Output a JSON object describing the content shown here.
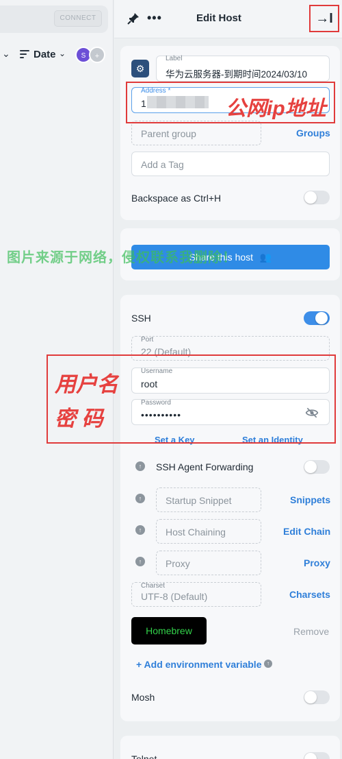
{
  "left": {
    "connect_label": "CONNECT",
    "sort_label": "Date",
    "avatar_initial": "S",
    "avatar_add": "+"
  },
  "header": {
    "title": "Edit Host",
    "more": "•••",
    "close_glyph": "→I"
  },
  "general": {
    "label_caption": "Label",
    "label_value": "华为云服务器-到期时间2024/03/10",
    "address_caption": "Address *",
    "address_value": "1",
    "address_note": "公网ip地址",
    "parent_group_placeholder": "Parent group",
    "groups_link": "Groups",
    "tag_placeholder": "Add a Tag",
    "backspace_label": "Backspace as Ctrl+H",
    "backspace_on": false
  },
  "share": {
    "button_label": "Share this host"
  },
  "watermark": "图片来源于网络，侵权联系我删除！",
  "ssh": {
    "title": "SSH",
    "enabled": true,
    "port_caption": "Port",
    "port_value": "22 (Default)",
    "username_caption": "Username",
    "username_value": "root",
    "password_caption": "Password",
    "password_value": "••••••••••",
    "credentials_note_1": "用户名",
    "credentials_note_2": "密  码",
    "set_key_link": "Set a Key",
    "set_identity_link": "Set an Identity",
    "agent_forwarding_label": "SSH Agent Forwarding",
    "agent_forwarding_on": false,
    "startup_snippet_placeholder": "Startup Snippet",
    "snippets_link": "Snippets",
    "host_chaining_placeholder": "Host Chaining",
    "edit_chain_link": "Edit Chain",
    "proxy_placeholder": "Proxy",
    "proxy_link": "Proxy",
    "charset_caption": "Charset",
    "charset_value": "UTF-8 (Default)",
    "charsets_link": "Charsets",
    "homebrew_label": "Homebrew",
    "remove_label": "Remove",
    "add_env_label": "+ Add environment variable",
    "mosh_label": "Mosh",
    "mosh_on": false
  },
  "telnet": {
    "title": "Telnet"
  },
  "colors": {
    "accent": "#2f7fd9",
    "annotation": "#e03a3a",
    "watermark": "#3cbe5a"
  }
}
